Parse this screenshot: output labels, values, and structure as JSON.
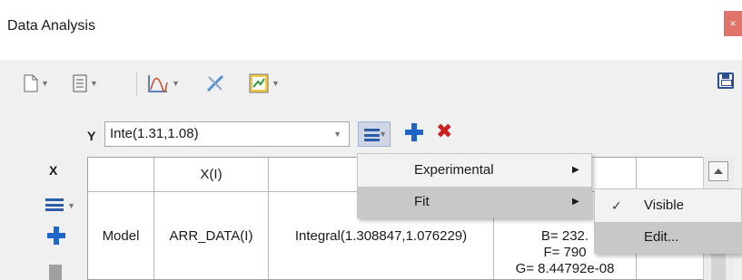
{
  "window": {
    "title": "Data Analysis",
    "close_glyph": "×"
  },
  "toolbar": {
    "new_icon": "new-document-icon",
    "template_icon": "template-icon",
    "curve_icon": "curve-fit-icon",
    "tools_icon": "tools-icon",
    "chart_icon": "chart-icon",
    "save_icon": "save-icon"
  },
  "y_selector": {
    "label": "Y",
    "value": "Inte(1.31,1.08)"
  },
  "x_selector": {
    "label": "X"
  },
  "grid": {
    "header": [
      "",
      "X(I)",
      ""
    ],
    "row": {
      "type": "Model",
      "x": "ARR_DATA(I)",
      "function": "Integral(1.308847,1.076229)",
      "params": [
        "B= 232.",
        "F= 790",
        "G= 8.44792e-08"
      ]
    }
  },
  "menu": {
    "items": [
      {
        "label": "Experimental",
        "has_submenu": true
      },
      {
        "label": "Fit",
        "has_submenu": true
      }
    ]
  },
  "submenu": {
    "items": [
      {
        "label": "Visible",
        "checked": true
      },
      {
        "label": "Edit..."
      }
    ]
  },
  "colors": {
    "accent_blue": "#1f66c8",
    "delete_red": "#cc2020",
    "close_red": "#e0736a"
  }
}
